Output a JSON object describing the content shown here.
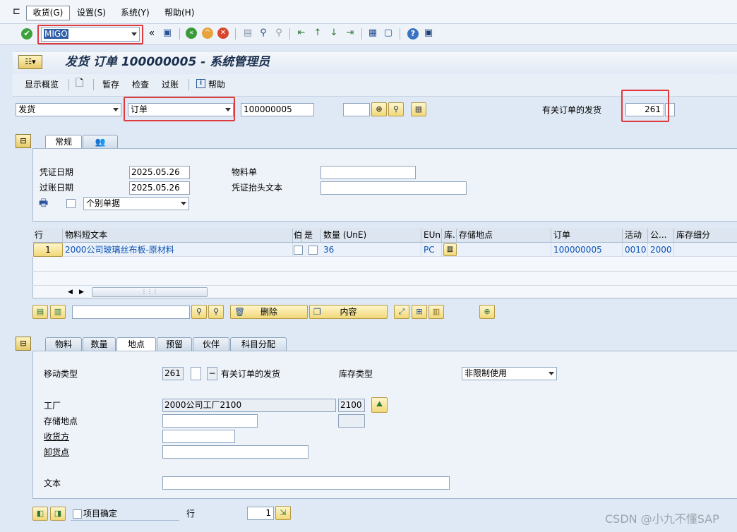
{
  "menu": {
    "items": [
      "收货(G)",
      "设置(S)",
      "系统(Y)",
      "帮助(H)"
    ]
  },
  "command": {
    "value": "MIGO"
  },
  "title": "发货 订单 100000005 - 系统管理员",
  "app_toolbar": {
    "display_overview": "显示概览",
    "hold": "暂存",
    "check": "检查",
    "post": "过账",
    "help": "帮助"
  },
  "header": {
    "action": "发货",
    "reference": "订单",
    "order_number": "100000005",
    "movement_label": "有关订单的发货",
    "movement_type": "261"
  },
  "tabs_top": [
    "常规"
  ],
  "general": {
    "doc_date_label": "凭证日期",
    "doc_date": "2025.05.26",
    "post_date_label": "过账日期",
    "post_date": "2025.05.26",
    "material_slip_label": "物料单",
    "header_text_label": "凭证抬头文本",
    "print_option": "个别单据"
  },
  "table": {
    "headers": [
      "行",
      "物料短文本",
      "伯",
      "是",
      "数量 (UnE)",
      "EUn",
      "库.",
      "存储地点",
      "订单",
      "活动",
      "公...",
      "库存细分"
    ],
    "row": {
      "line": "1",
      "material_text": "2000公司玻璃丝布板-原材料",
      "quantity": "36",
      "unit": "PC",
      "order": "100000005",
      "activity": "0010",
      "company": "2000"
    }
  },
  "table_toolbar": {
    "delete": "删除",
    "content": "内容"
  },
  "detail_tabs": [
    "物料",
    "数量",
    "地点",
    "预留",
    "伙伴",
    "科目分配"
  ],
  "detail": {
    "movement_type_label": "移动类型",
    "movement_type": "261",
    "minus": "−",
    "movement_desc": "有关订单的发货",
    "stock_type_label": "库存类型",
    "stock_type": "非限制使用",
    "plant_label": "工厂",
    "plant_name": "2000公司工厂2100",
    "plant_code": "2100",
    "storage_label": "存储地点",
    "recipient_label": "收货方",
    "unloading_label": "卸货点",
    "text_label": "文本"
  },
  "footer": {
    "item_ok": "项目确定",
    "line_label": "行",
    "line_value": "1"
  },
  "watermark": "CSDN @小九不懂SAP"
}
